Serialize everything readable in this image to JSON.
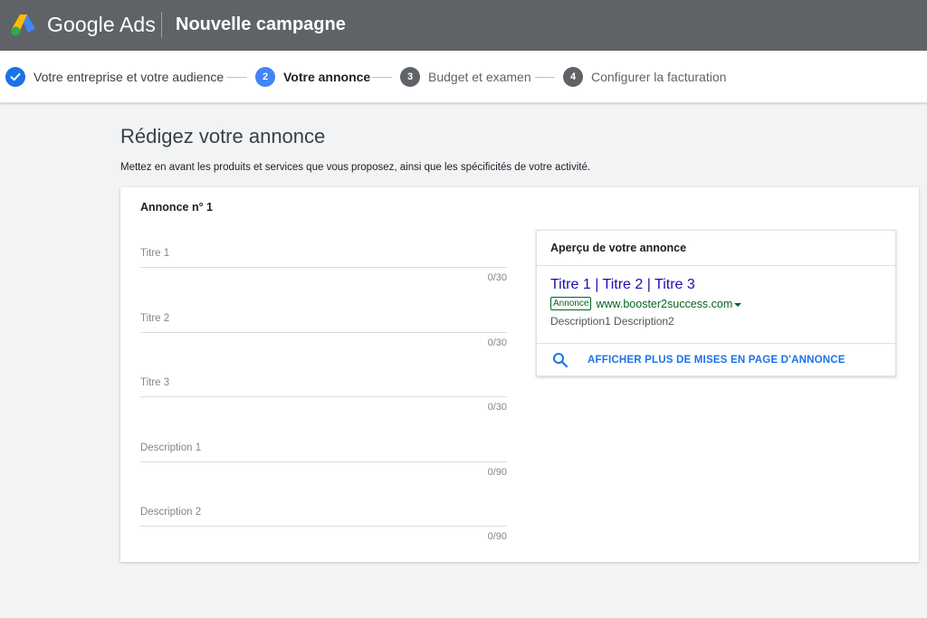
{
  "header": {
    "brand": "Google Ads",
    "campaign_title": "Nouvelle campagne",
    "colors": {
      "bar": "#5f6368",
      "logo_blue": "#4285f4",
      "logo_yellow": "#fbbc04",
      "logo_green": "#34a853"
    }
  },
  "stepper": {
    "steps": [
      {
        "number": "",
        "label": "Votre entreprise et votre audience",
        "state": "done"
      },
      {
        "number": "2",
        "label": "Votre annonce",
        "state": "active"
      },
      {
        "number": "3",
        "label": "Budget et examen",
        "state": "todo"
      },
      {
        "number": "4",
        "label": "Configurer la facturation",
        "state": "todo"
      }
    ]
  },
  "page": {
    "heading": "Rédigez votre annonce",
    "subtitle": "Mettez en avant les produits et services que vous proposez, ainsi que les spécificités de votre activité."
  },
  "ad_form": {
    "ad_number": "Annonce n° 1",
    "fields": [
      {
        "label": "Titre 1",
        "value": "",
        "counter": "0/30"
      },
      {
        "label": "Titre 2",
        "value": "",
        "counter": "0/30"
      },
      {
        "label": "Titre 3",
        "value": "",
        "counter": "0/30"
      },
      {
        "label": "Description 1",
        "value": "",
        "counter": "0/90"
      },
      {
        "label": "Description 2",
        "value": "",
        "counter": "0/90"
      }
    ]
  },
  "preview": {
    "title": "Aperçu de votre annonce",
    "headline": "Titre 1 | Titre 2 | Titre 3",
    "badge": "Annonce",
    "url": "www.booster2success.com",
    "description": "Description1 Description2",
    "more_layouts": "AFFICHER PLUS DE MISES EN PAGE D'ANNONCE",
    "colors": {
      "headline": "#1a0dab",
      "url": "#006621",
      "link": "#1a73e8"
    }
  }
}
